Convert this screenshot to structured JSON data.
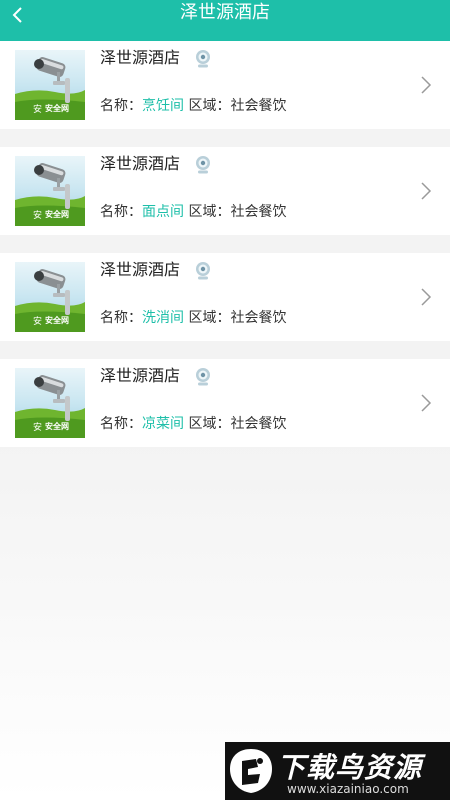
{
  "header": {
    "title": "泽世源酒店",
    "back_icon": "chevron-left-icon",
    "background": "#1ebfa9"
  },
  "cameras": [
    {
      "title": "泽世源酒店",
      "name_label": "名称：",
      "name_value": "烹饪间",
      "area_label": "区域：",
      "area_value": "社会餐饮"
    },
    {
      "title": "泽世源酒店",
      "name_label": "名称：",
      "name_value": "面点间",
      "area_label": "区域：",
      "area_value": "社会餐饮"
    },
    {
      "title": "泽世源酒店",
      "name_label": "名称：",
      "name_value": "洗消间",
      "area_label": "区域：",
      "area_value": "社会餐饮"
    },
    {
      "title": "泽世源酒店",
      "name_label": "名称：",
      "name_value": "凉菜间",
      "area_label": "区域：",
      "area_value": "社会餐饮"
    }
  ],
  "thumbnail": {
    "text": "安全网",
    "icon": "security-camera-icon"
  },
  "watermark": {
    "title": "下载鸟资源",
    "url": "www.xiazainiao.com"
  },
  "colors": {
    "accent": "#1ebfa9",
    "divider": "#f0f0f0"
  }
}
